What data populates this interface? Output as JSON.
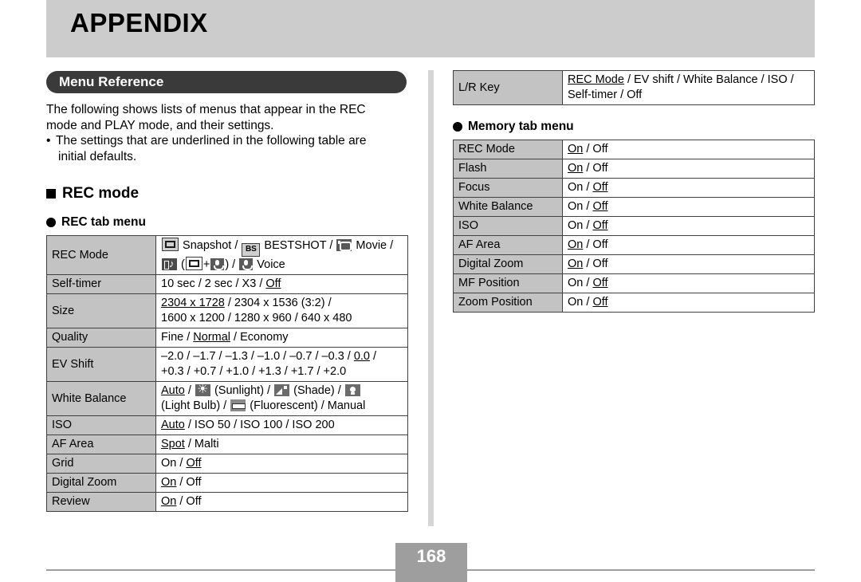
{
  "header": {
    "title": "APPENDIX"
  },
  "section": {
    "pill_label": "Menu Reference",
    "intro_line1": "The following shows lists of menus that appear in the REC",
    "intro_line2": "mode and PLAY mode, and their settings.",
    "intro_bullet1": "The settings that are underlined in the following table are",
    "intro_bullet2": "initial defaults.",
    "heading_rec_mode": "REC mode",
    "heading_rec_tab_menu": "REC tab menu",
    "heading_memory_tab_menu": "Memory tab menu"
  },
  "rec_tab_menu": {
    "rows": [
      {
        "key": "REC Mode",
        "line1_parts": [
          {
            "type": "icon",
            "name": "snapshot-icon"
          },
          {
            "type": "text",
            "text": " Snapshot / "
          },
          {
            "type": "icon",
            "name": "bestshot-icon",
            "text": "BS"
          },
          {
            "type": "text",
            "text": " BESTSHOT / "
          },
          {
            "type": "icon",
            "name": "movie-icon"
          },
          {
            "type": "text",
            "text": " Movie /"
          }
        ],
        "line2_parts": [
          {
            "type": "icon",
            "name": "snapshot-plus-voice-icon"
          },
          {
            "type": "text",
            "text": " ("
          },
          {
            "type": "icon",
            "name": "snapshot-outline-icon"
          },
          {
            "type": "text",
            "text": "+"
          },
          {
            "type": "icon",
            "name": "microphone-icon"
          },
          {
            "type": "text",
            "text": ") / "
          },
          {
            "type": "icon",
            "name": "microphone-icon"
          },
          {
            "type": "text",
            "text": " Voice"
          }
        ]
      },
      {
        "key": "Self-timer",
        "value": "10 sec / 2 sec / X3 / Off",
        "underlined": [
          "Off"
        ]
      },
      {
        "key": "Size",
        "line1": "2304 x 1728 / 2304 x 1536 (3:2) /",
        "line2": "1600 x 1200 / 1280 x 960 / 640 x 480",
        "underlined": [
          "2304 x 1728"
        ]
      },
      {
        "key": "Quality",
        "value": "Fine / Normal / Economy",
        "underlined": [
          "Normal"
        ]
      },
      {
        "key": "EV Shift",
        "line1": "–2.0 / –1.7 / –1.3 / –1.0 / –0.7 / –0.3 / 0.0 /",
        "line2": "+0.3 / +0.7 / +1.0 / +1.3 / +1.7 / +2.0",
        "underlined": [
          "0.0"
        ]
      },
      {
        "key": "White Balance",
        "line1_parts": [
          {
            "type": "text",
            "text": "Auto",
            "underline": true
          },
          {
            "type": "text",
            "text": " / "
          },
          {
            "type": "icon",
            "name": "sunlight-icon"
          },
          {
            "type": "text",
            "text": " (Sunlight) / "
          },
          {
            "type": "icon",
            "name": "shade-icon"
          },
          {
            "type": "text",
            "text": " (Shade) / "
          },
          {
            "type": "icon",
            "name": "light-bulb-icon"
          }
        ],
        "line2_parts": [
          {
            "type": "text",
            "text": "(Light Bulb) / "
          },
          {
            "type": "icon",
            "name": "fluorescent-icon"
          },
          {
            "type": "text",
            "text": " (Fluorescent) / Manual"
          }
        ]
      },
      {
        "key": "ISO",
        "value": "Auto / ISO 50 / ISO 100 / ISO 200",
        "underlined": [
          "Auto"
        ]
      },
      {
        "key": "AF Area",
        "value": "Spot / Malti",
        "underlined": [
          "Spot"
        ]
      },
      {
        "key": "Grid",
        "value": "On / Off",
        "underlined": [
          "Off"
        ]
      },
      {
        "key": "Digital Zoom",
        "value": "On / Off",
        "underlined": [
          "On"
        ]
      },
      {
        "key": "Review",
        "value": "On / Off",
        "underlined": [
          "On"
        ]
      }
    ],
    "cells": {
      "self_timer_key": "Self-timer",
      "self_timer_a": "10 sec / 2 sec / X3 / ",
      "self_timer_b": "Off",
      "size_key": "Size",
      "size_l1_a": "2304 x 1728",
      "size_l1_b": " / 2304 x 1536 (3:2) /",
      "size_l2": "1600 x 1200 / 1280 x 960 / 640 x 480",
      "quality_key": "Quality",
      "quality_a": "Fine / ",
      "quality_b": "Normal",
      "quality_c": " / Economy",
      "ev_key": "EV Shift",
      "ev_l1_a": "–2.0 / –1.7 / –1.3 / –1.0 / –0.7 / –0.3 / ",
      "ev_l1_b": "0.0",
      "ev_l1_c": " /",
      "ev_l2": "+0.3 / +0.7 / +1.0 / +1.3 / +1.7 / +2.0",
      "wb_key": "White Balance",
      "wb_auto": "Auto",
      "wb_sep1": " / ",
      "wb_sunlight": " (Sunlight) / ",
      "wb_shade": " (Shade) / ",
      "wb_lightbulb": "(Light Bulb) / ",
      "wb_fluor": " (Fluorescent) / Manual",
      "iso_key": "ISO",
      "iso_a": "Auto",
      "iso_b": " / ISO 50 / ISO 100 / ISO 200",
      "af_key": "AF Area",
      "af_a": "Spot",
      "af_b": " / Malti",
      "grid_key": "Grid",
      "grid_a": "On / ",
      "grid_b": "Off",
      "dz_key": "Digital Zoom",
      "dz_a": "On",
      "dz_b": " / Off",
      "review_key": "Review",
      "review_a": "On",
      "review_b": " / Off",
      "recmode_key": "REC Mode",
      "rm_snapshot": " Snapshot / ",
      "rm_bs_label": "BS",
      "rm_bestshot": " BESTSHOT / ",
      "rm_movie": " Movie /",
      "rm_open_paren": " (",
      "rm_plus": "+",
      "rm_close_paren": ") / ",
      "rm_voice": " Voice"
    }
  },
  "lr_key_table": {
    "key": "L/R Key",
    "l1_a": "REC Mode",
    "l1_b": " / EV shift / White Balance / ISO /",
    "l2": "Self-timer / Off"
  },
  "memory_tab_menu": {
    "rows": [
      {
        "key": "REC Mode",
        "a": "On",
        "a_u": true,
        "b": " / Off",
        "b_u": false
      },
      {
        "key": "Flash",
        "a": "On",
        "a_u": true,
        "b": " / Off",
        "b_u": false
      },
      {
        "key": "Focus",
        "a": "On / ",
        "a_u": false,
        "b": "Off",
        "b_u": true
      },
      {
        "key": "White Balance",
        "a": "On / ",
        "a_u": false,
        "b": "Off",
        "b_u": true
      },
      {
        "key": "ISO",
        "a": "On / ",
        "a_u": false,
        "b": "Off",
        "b_u": true
      },
      {
        "key": "AF Area",
        "a": "On",
        "a_u": true,
        "b": " / Off",
        "b_u": false
      },
      {
        "key": "Digital Zoom",
        "a": "On",
        "a_u": true,
        "b": " / Off",
        "b_u": false
      },
      {
        "key": "MF Position",
        "a": "On / ",
        "a_u": false,
        "b": "Off",
        "b_u": true
      },
      {
        "key": "Zoom Position",
        "a": "On / ",
        "a_u": false,
        "b": "Off",
        "b_u": true
      }
    ]
  },
  "footer": {
    "page_number": "168"
  },
  "colors": {
    "banner_gray": "#cccccc",
    "pill_dark": "#3a3a3a",
    "table_key_gray": "#c3c3c3",
    "table_border": "#404040",
    "footer_gray": "#9e9e9e"
  }
}
